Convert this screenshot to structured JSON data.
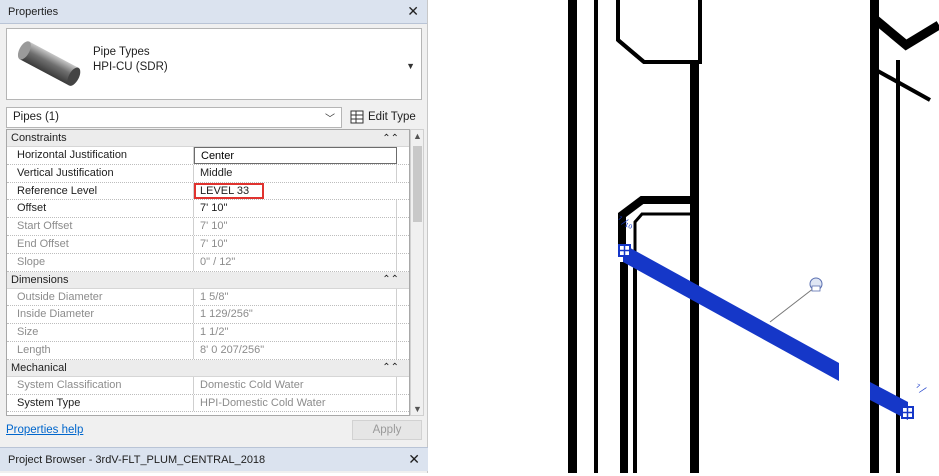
{
  "properties": {
    "title": "Properties",
    "type_selector": {
      "family": "Pipe Types",
      "type": "HPI-CU (SDR)"
    },
    "instance_filter": "Pipes (1)",
    "edit_type_label": "Edit Type",
    "sections": [
      {
        "name": "Constraints",
        "rows": [
          {
            "name": "Horizontal Justification",
            "value": "Center"
          },
          {
            "name": "Vertical Justification",
            "value": "Middle"
          },
          {
            "name": "Reference Level",
            "value": "LEVEL 33"
          },
          {
            "name": "Offset",
            "value": "7'  10\""
          },
          {
            "name": "Start Offset",
            "value": "7'  10\""
          },
          {
            "name": "End Offset",
            "value": "7'  10\""
          },
          {
            "name": "Slope",
            "value": "0\" / 12\""
          }
        ]
      },
      {
        "name": "Dimensions",
        "rows": [
          {
            "name": "Outside Diameter",
            "value": "1 5/8\""
          },
          {
            "name": "Inside Diameter",
            "value": "1 129/256\""
          },
          {
            "name": "Size",
            "value": "1 1/2\""
          },
          {
            "name": "Length",
            "value": "8'  0 207/256\""
          }
        ]
      },
      {
        "name": "Mechanical",
        "rows": [
          {
            "name": "System Classification",
            "value": "Domestic Cold Water"
          },
          {
            "name": "System Type",
            "value": "HPI-Domestic Cold Water"
          }
        ]
      }
    ],
    "help_link": "Properties help",
    "apply_label": "Apply"
  },
  "project_browser": {
    "title": "Project Browser - 3rdV-FLT_PLUM_CENTRAL_2018"
  },
  "colors": {
    "pipe_selected": "#1537c8",
    "highlight": "#e0332f"
  }
}
